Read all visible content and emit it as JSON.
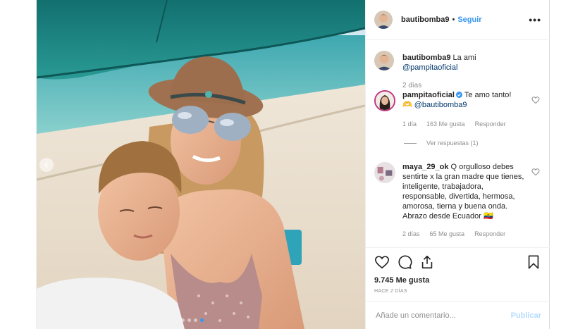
{
  "post": {
    "author": "bautibomba9",
    "follow_label": "Seguir",
    "bullet": "•",
    "more": "•••"
  },
  "caption": {
    "user": "bautibomba9",
    "text": "La ami",
    "mention": "@pampitaoficial",
    "time": "2 días"
  },
  "comments": [
    {
      "user": "pampitaoficial",
      "verified": true,
      "text": "Te amo tanto!",
      "line2_emoji": "🫶",
      "mention": "@bautibomba9",
      "time": "1 día",
      "likes": "163 Me gusta",
      "reply": "Responder",
      "view_replies": "Ver respuestas (1)"
    },
    {
      "user": "maya_29_ok",
      "text": "Q orgulloso debes sentirte x la gran madre que tienes, inteligente, trabajadora, responsable, divertida, hermosa, amorosa, tierna y buena onda. Abrazo desde Ecuador 🇪🇨",
      "time": "2 días",
      "likes": "65 Me gusta",
      "reply": "Responder"
    }
  ],
  "actions": {
    "likes": "9.745 Me gusta",
    "timestamp": "HACE 2 DÍAS"
  },
  "add_comment": {
    "placeholder": "Añade un comentario...",
    "publish": "Publicar"
  },
  "icons": {
    "like": "heart-icon",
    "comment": "comment-icon",
    "share": "share-icon",
    "save": "bookmark-icon",
    "prev": "chevron-left-icon"
  },
  "carousel": {
    "total": 4,
    "active_index": 3
  },
  "colors": {
    "accent": "#3897f0",
    "publish_disabled": "#b3dbff",
    "secondary_text": "#8e8e8e"
  }
}
